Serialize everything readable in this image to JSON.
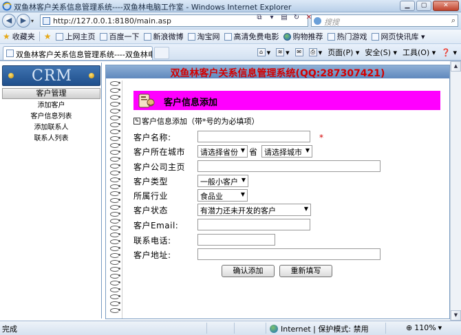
{
  "window": {
    "title": "双鱼林客户关系信息管理系统----双鱼林电脑工作室 - Windows Internet Explorer"
  },
  "address": {
    "url": "http://127.0.0.1:8180/main.asp",
    "search_placeholder": "搜搜"
  },
  "favorites": {
    "label": "收藏夹",
    "items": [
      "上网主页",
      "百度一下",
      "新浪微博",
      "淘宝网",
      "高清免费电影",
      "购物推荐",
      "热门游戏",
      "网页快讯库 ▾"
    ]
  },
  "tabs": [
    {
      "label": "双鱼林客户关系信息管理系统----双鱼林电脑工作..."
    }
  ],
  "commands": {
    "page": "页面(P) ▾",
    "safety": "安全(S) ▾",
    "tools": "工具(O) ▾",
    "help": "❓ ▾"
  },
  "sidebar": {
    "logo": "CRM",
    "section": "客户管理",
    "items": [
      "添加客户",
      "客户信息列表",
      "添加联系人",
      "联系人列表"
    ]
  },
  "main": {
    "header": "双鱼林客户关系信息管理系统(QQ:287307421)",
    "banner": "客户信息添加",
    "hint": "客户信息添加（带*号的为必填项）"
  },
  "form": {
    "name_label": "客户名称:",
    "required_mark": "*",
    "city_label": "客户所在城市",
    "province_value": "请选择省份",
    "province_suffix": "省",
    "city_value": "请选择城市",
    "homepage_label": "客户公司主页",
    "type_label": "客户类型",
    "type_value": "一般小客户",
    "industry_label": "所属行业",
    "industry_value": "食品业",
    "status_label": "客户状态",
    "status_value": "有潜力还未开发的客户",
    "email_label": "客户Email:",
    "phone_label": "联系电话:",
    "address_label": "客户地址:",
    "submit_label": "确认添加",
    "reset_label": "重新填写"
  },
  "status": {
    "text": "完成",
    "zone": "Internet | 保护模式: 禁用",
    "zoom": "110%"
  }
}
